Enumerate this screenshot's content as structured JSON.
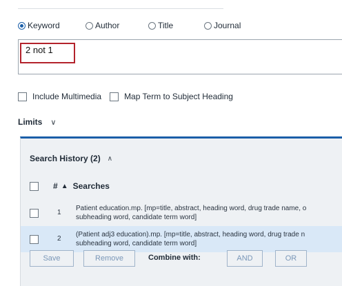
{
  "search_type": {
    "options": [
      {
        "label": "Keyword",
        "checked": true
      },
      {
        "label": "Author",
        "checked": false
      },
      {
        "label": "Title",
        "checked": false
      },
      {
        "label": "Journal",
        "checked": false
      }
    ]
  },
  "search": {
    "query": "2 not 1"
  },
  "options": {
    "multimedia_label": "Include Multimedia",
    "map_term_label": "Map Term to Subject Heading"
  },
  "limits": {
    "label": "Limits"
  },
  "history": {
    "title": "Search History (2)",
    "col_num": "#",
    "col_sort_icon": "▲",
    "col_searches": "Searches",
    "rows": [
      {
        "num": "1",
        "line1": "Patient education.mp. [mp=title, abstract, heading word, drug trade name, o",
        "line2": "subheading word, candidate term word]"
      },
      {
        "num": "2",
        "line1": "(Patient adj3 education).mp. [mp=title, abstract, heading word, drug trade n",
        "line2": "subheading word, candidate term word]"
      }
    ],
    "save_label": "Save",
    "remove_label": "Remove",
    "combine_label": "Combine with:",
    "and_label": "AND",
    "or_label": "OR"
  },
  "colors": {
    "accent": "#1a5ea8",
    "highlight": "#b3222b",
    "selected_row": "#d9e8f7"
  }
}
